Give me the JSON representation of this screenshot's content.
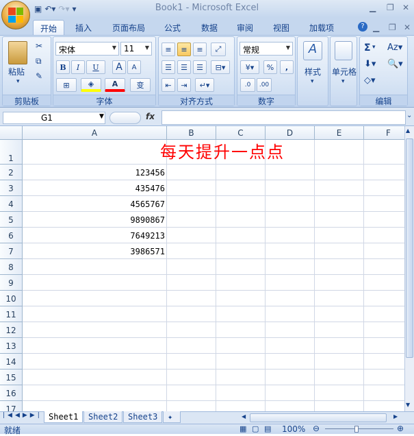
{
  "window": {
    "title": "Book1 - Microsoft Excel"
  },
  "tabs": [
    "开始",
    "插入",
    "页面布局",
    "公式",
    "数据",
    "审阅",
    "视图",
    "加载项"
  ],
  "ribbon": {
    "clipboard": {
      "paste": "粘贴",
      "label": "剪贴板"
    },
    "font": {
      "name": "宋体",
      "size": "11",
      "bold": "B",
      "italic": "I",
      "underline": "U",
      "grow": "A",
      "shrink": "A",
      "color": "A",
      "phonetic": "变",
      "label": "字体"
    },
    "alignment": {
      "label": "对齐方式"
    },
    "number": {
      "format": "常规",
      "percent": "%",
      "comma": ",",
      "label": "数字"
    },
    "styles": {
      "label": "样式"
    },
    "cells": {
      "label": "单元格"
    },
    "editing": {
      "sum": "Σ",
      "label": "编辑"
    }
  },
  "formula_bar": {
    "name_box": "G1",
    "fx": "fx",
    "formula": ""
  },
  "columns": [
    "A",
    "B",
    "C",
    "D",
    "E",
    "F"
  ],
  "rows": [
    "1",
    "2",
    "3",
    "4",
    "5",
    "6",
    "7",
    "8",
    "9",
    "10",
    "11",
    "12",
    "13",
    "14",
    "15",
    "16",
    "17"
  ],
  "cells": {
    "A1": "每天提升一点点",
    "A2": "123456",
    "A3": "435476",
    "A4": "4565767",
    "A5": "9890867",
    "A6": "7649213",
    "A7": "3986571"
  },
  "sheets": [
    "Sheet1",
    "Sheet2",
    "Sheet3"
  ],
  "status": {
    "ready": "就绪",
    "zoom": "100%"
  },
  "colors": {
    "title_text": "#ff0000",
    "accent": "#15428b"
  }
}
